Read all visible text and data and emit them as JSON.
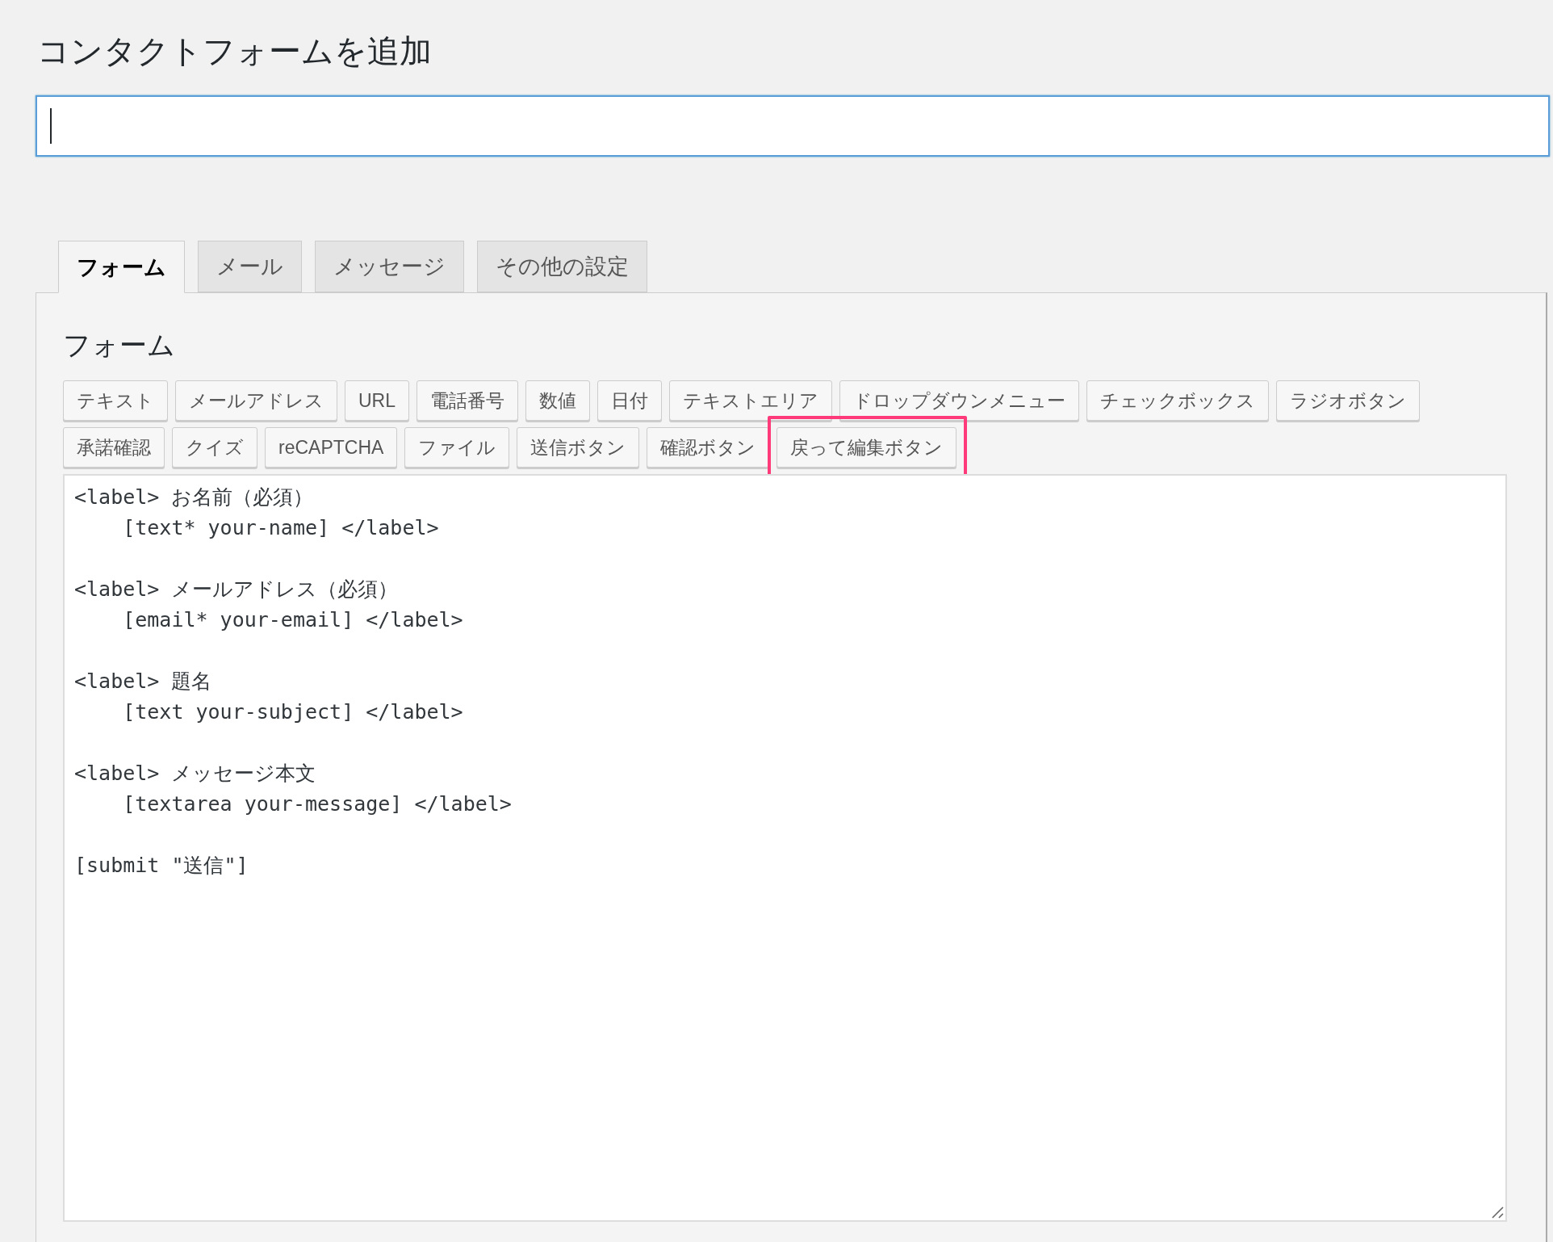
{
  "page_title": "コンタクトフォームを追加",
  "title_field": {
    "focused": true
  },
  "tabs": [
    {
      "label": "フォーム",
      "selected": true
    },
    {
      "label": "メール",
      "selected": false
    },
    {
      "label": "メッセージ",
      "selected": false
    },
    {
      "label": "その他の設定",
      "selected": false
    }
  ],
  "panel": {
    "heading": "フォーム",
    "tag_button_rows": [
      [
        {
          "label": "テキスト",
          "highlighted": false
        },
        {
          "label": "メールアドレス",
          "highlighted": false
        },
        {
          "label": "URL",
          "highlighted": false
        },
        {
          "label": "電話番号",
          "highlighted": false
        },
        {
          "label": "数値",
          "highlighted": false
        },
        {
          "label": "日付",
          "highlighted": false
        },
        {
          "label": "テキストエリア",
          "highlighted": false
        },
        {
          "label": "ドロップダウンメニュー",
          "highlighted": false
        },
        {
          "label": "チェックボックス",
          "highlighted": false
        },
        {
          "label": "ラジオボタン",
          "highlighted": false
        }
      ],
      [
        {
          "label": "承諾確認",
          "highlighted": false
        },
        {
          "label": "クイズ",
          "highlighted": false
        },
        {
          "label": "reCAPTCHA",
          "highlighted": false
        },
        {
          "label": "ファイル",
          "highlighted": false
        },
        {
          "label": "送信ボタン",
          "highlighted": false
        },
        {
          "label": "確認ボタン",
          "highlighted": false
        },
        {
          "label": "戻って編集ボタン",
          "highlighted": true
        }
      ]
    ],
    "code_blocks": [
      [
        "<label> お名前（必須）",
        "    [text* your-name] </label>"
      ],
      [
        "<label> メールアドレス（必須）",
        "    [email* your-email] </label>"
      ],
      [
        "<label> 題名",
        "    [text your-subject] </label>"
      ],
      [
        "<label> メッセージ本文",
        "    [textarea your-message] </label>"
      ],
      [
        "[submit \"送信\"]"
      ]
    ]
  }
}
